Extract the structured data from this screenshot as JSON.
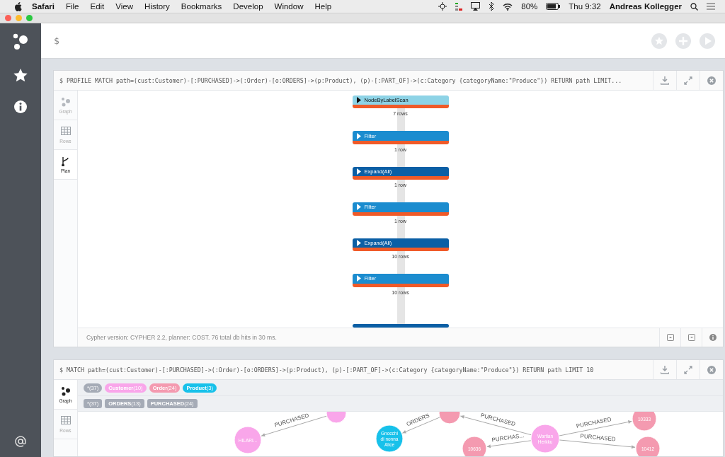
{
  "menu_bar": {
    "items": [
      {
        "label": "Safari",
        "bold": true
      },
      {
        "label": "File",
        "bold": false
      },
      {
        "label": "Edit",
        "bold": false
      },
      {
        "label": "View",
        "bold": false
      },
      {
        "label": "History",
        "bold": false
      },
      {
        "label": "Bookmarks",
        "bold": false
      },
      {
        "label": "Develop",
        "bold": false
      },
      {
        "label": "Window",
        "bold": false
      },
      {
        "label": "Help",
        "bold": false
      }
    ],
    "battery": "80%",
    "clock": "Thu 9:32",
    "user": "Andreas Kollegger"
  },
  "editor": {
    "prompt": "$"
  },
  "frames": [
    {
      "query": "$ PROFILE MATCH path=(cust:Customer)-[:PURCHASED]->(:Order)-[o:ORDERS]->(p:Product), (p)-[:PART_OF]->(c:Category {categoryName:\"Produce\"}) RETURN path LIMIT...",
      "tabs": [
        {
          "label": "Graph",
          "selected": false
        },
        {
          "label": "Rows",
          "selected": false
        },
        {
          "label": "Plan",
          "selected": true
        }
      ],
      "plan": [
        {
          "name": "NodeByLabelScan",
          "kind": "scan",
          "rows": "7 rows"
        },
        {
          "name": "Filter",
          "kind": "filter",
          "rows": "1 row"
        },
        {
          "name": "Expand(All)",
          "kind": "expand",
          "rows": "1 row"
        },
        {
          "name": "Filter",
          "kind": "filter",
          "rows": "1 row"
        },
        {
          "name": "Expand(All)",
          "kind": "expand",
          "rows": "10 rows"
        },
        {
          "name": "Filter",
          "kind": "filter",
          "rows": "10 rows"
        }
      ],
      "footer": "Cypher version: CYPHER 2.2, planner: COST. 76 total db hits in 30 ms."
    },
    {
      "query": "$ MATCH path=(cust:Customer)-[:PURCHASED]->(:Order)-[o:ORDERS]->(p:Product), (p)-[:PART_OF]->(c:Category {categoryName:\"Produce\"}) RETURN path LIMIT 10",
      "tabs": [
        {
          "label": "Graph",
          "selected": true
        },
        {
          "label": "Rows",
          "selected": false
        }
      ],
      "node_labels": [
        {
          "text": "*(37)",
          "color": "#a5abb6"
        },
        {
          "text": "**Customer**(10)",
          "color": "#f9a6ea"
        },
        {
          "text": "**Order**(24)",
          "color": "#f49ab0"
        },
        {
          "text": "**Product**(3)",
          "color": "#17c1ea"
        }
      ],
      "relationship_types": [
        {
          "text": "*(37)"
        },
        {
          "text": "**ORDERS**(13)"
        },
        {
          "text": "**PURCHASED**(24)"
        }
      ],
      "graph": {
        "nodes": [
          {
            "label": "HILARI...",
            "color": "#f9a6ea"
          },
          {
            "color": "#f9a6ea"
          },
          {
            "label": "Gnocchi di nonna Alice",
            "color": "#17c1ea"
          },
          {
            "color": "#f49ab0"
          },
          {
            "label": "Wartian Herkku",
            "color": "#f9a6ea"
          },
          {
            "label": "10636",
            "color": "#f49ab0"
          },
          {
            "label": "10412",
            "color": "#f49ab0"
          },
          {
            "label": "10333",
            "color": "#f49ab0"
          }
        ],
        "edges": [
          {
            "label": "PURCHASED"
          },
          {
            "label": "ORDERS"
          },
          {
            "label": "PURCHASED"
          },
          {
            "label": "PURCHAS..."
          },
          {
            "label": "PURCHASED"
          },
          {
            "label": "PURCHASED"
          }
        ]
      }
    }
  ]
}
